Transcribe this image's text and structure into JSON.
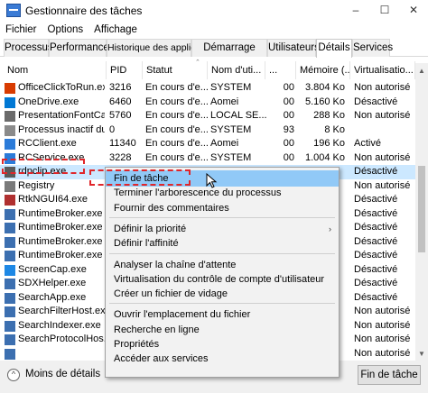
{
  "window": {
    "title": "Gestionnaire des tâches",
    "minimize": "–",
    "maximize": "☐",
    "close": "✕"
  },
  "menu": [
    "Fichier",
    "Options",
    "Affichage"
  ],
  "tabs": [
    "Processus",
    "Performance",
    "Historique des applications",
    "Démarrage",
    "Utilisateurs",
    "Détails",
    "Services"
  ],
  "active_tab": "Détails",
  "columns": [
    "Nom",
    "PID",
    "Statut",
    "Nom d'uti...",
    "...",
    "Mémoire (...",
    "Virtualisatio..."
  ],
  "rows": [
    {
      "name": "OfficeClickToRun.exe",
      "pid": "3216",
      "status": "En cours d'e...",
      "user": "SYSTEM",
      "cpu": "00",
      "mem": "3.804 Ko",
      "virt": "Non autorisé",
      "icon_color": "#d83b01"
    },
    {
      "name": "OneDrive.exe",
      "pid": "6460",
      "status": "En cours d'e...",
      "user": "Aomei",
      "cpu": "00",
      "mem": "5.160 Ko",
      "virt": "Désactivé",
      "icon_color": "#0078d4"
    },
    {
      "name": "PresentationFontCac...",
      "pid": "5760",
      "status": "En cours d'e...",
      "user": "LOCAL SE...",
      "cpu": "00",
      "mem": "288 Ko",
      "virt": "Non autorisé",
      "icon_color": "#6a6a6a"
    },
    {
      "name": "Processus inactif du ...",
      "pid": "0",
      "status": "En cours d'e...",
      "user": "SYSTEM",
      "cpu": "93",
      "mem": "8 Ko",
      "virt": "",
      "icon_color": "#8a8a8a"
    },
    {
      "name": "RCClient.exe",
      "pid": "11340",
      "status": "En cours d'e...",
      "user": "Aomei",
      "cpu": "00",
      "mem": "196 Ko",
      "virt": "Activé",
      "icon_color": "#2b7bd9"
    },
    {
      "name": "RCService.exe",
      "pid": "3228",
      "status": "En cours d'e...",
      "user": "SYSTEM",
      "cpu": "00",
      "mem": "1.004 Ko",
      "virt": "Non autorisé",
      "icon_color": "#2b7bd9"
    },
    {
      "name": "rdpclip.exe",
      "pid": "",
      "status": "",
      "user": "",
      "cpu": "",
      "mem": "",
      "virt": "Désactivé",
      "icon_color": "#5a5a5a"
    },
    {
      "name": "Registry",
      "pid": "",
      "status": "",
      "user": "",
      "cpu": "",
      "mem": "",
      "virt": "Non autorisé",
      "icon_color": "#7a7a7a"
    },
    {
      "name": "RtkNGUI64.exe",
      "pid": "",
      "status": "",
      "user": "",
      "cpu": "",
      "mem": "",
      "virt": "Désactivé",
      "icon_color": "#b03030"
    },
    {
      "name": "RuntimeBroker.exe",
      "pid": "",
      "status": "",
      "user": "",
      "cpu": "",
      "mem": "",
      "virt": "Désactivé",
      "icon_color": "#3c6fb0"
    },
    {
      "name": "RuntimeBroker.exe",
      "pid": "",
      "status": "",
      "user": "",
      "cpu": "",
      "mem": "",
      "virt": "Désactivé",
      "icon_color": "#3c6fb0"
    },
    {
      "name": "RuntimeBroker.exe",
      "pid": "",
      "status": "",
      "user": "",
      "cpu": "",
      "mem": "",
      "virt": "Désactivé",
      "icon_color": "#3c6fb0"
    },
    {
      "name": "RuntimeBroker.exe",
      "pid": "",
      "status": "",
      "user": "",
      "cpu": "",
      "mem": "",
      "virt": "Désactivé",
      "icon_color": "#3c6fb0"
    },
    {
      "name": "ScreenCap.exe",
      "pid": "",
      "status": "",
      "user": "",
      "cpu": "",
      "mem": "",
      "virt": "Désactivé",
      "icon_color": "#1e88e5"
    },
    {
      "name": "SDXHelper.exe",
      "pid": "",
      "status": "",
      "user": "",
      "cpu": "",
      "mem": "",
      "virt": "Désactivé",
      "icon_color": "#3c6fb0"
    },
    {
      "name": "SearchApp.exe",
      "pid": "",
      "status": "",
      "user": "",
      "cpu": "",
      "mem": "",
      "virt": "Désactivé",
      "icon_color": "#3c6fb0"
    },
    {
      "name": "SearchFilterHost.exe",
      "pid": "",
      "status": "",
      "user": "",
      "cpu": "",
      "mem": "",
      "virt": "Non autorisé",
      "icon_color": "#3c6fb0"
    },
    {
      "name": "SearchIndexer.exe",
      "pid": "",
      "status": "",
      "user": "",
      "cpu": "",
      "mem": "",
      "virt": "Non autorisé",
      "icon_color": "#3c6fb0"
    },
    {
      "name": "SearchProtocolHos...",
      "pid": "",
      "status": "",
      "user": "",
      "cpu": "",
      "mem": "",
      "virt": "Non autorisé",
      "icon_color": "#3c6fb0"
    },
    {
      "name": "",
      "pid": "",
      "status": "",
      "user": "",
      "cpu": "",
      "mem": "",
      "virt": "Non autorisé",
      "icon_color": "#3c6fb0"
    }
  ],
  "selected_row_name": "rdpclip.exe",
  "context_menu": [
    {
      "label": "Fin de tâche",
      "highlighted": true
    },
    {
      "label": "Terminer l'arborescence du processus"
    },
    {
      "label": "Fournir des commentaires"
    },
    {
      "separator": true
    },
    {
      "label": "Définir la priorité",
      "submenu": true
    },
    {
      "label": "Définir l'affinité"
    },
    {
      "separator": true
    },
    {
      "label": "Analyser la chaîne d'attente"
    },
    {
      "label": "Virtualisation du contrôle de compte d'utilisateur"
    },
    {
      "label": "Créer un fichier de vidage"
    },
    {
      "separator": true
    },
    {
      "label": "Ouvrir l'emplacement du fichier"
    },
    {
      "label": "Recherche en ligne"
    },
    {
      "label": "Propriétés"
    },
    {
      "label": "Accéder aux services"
    }
  ],
  "footer": {
    "fewer_details": "Moins de détails",
    "end_task": "Fin de tâche"
  },
  "colors": {
    "selected_row": "#cce8ff",
    "menu_highlight": "#91c9f7",
    "dashed_highlight": "#e0262a"
  }
}
